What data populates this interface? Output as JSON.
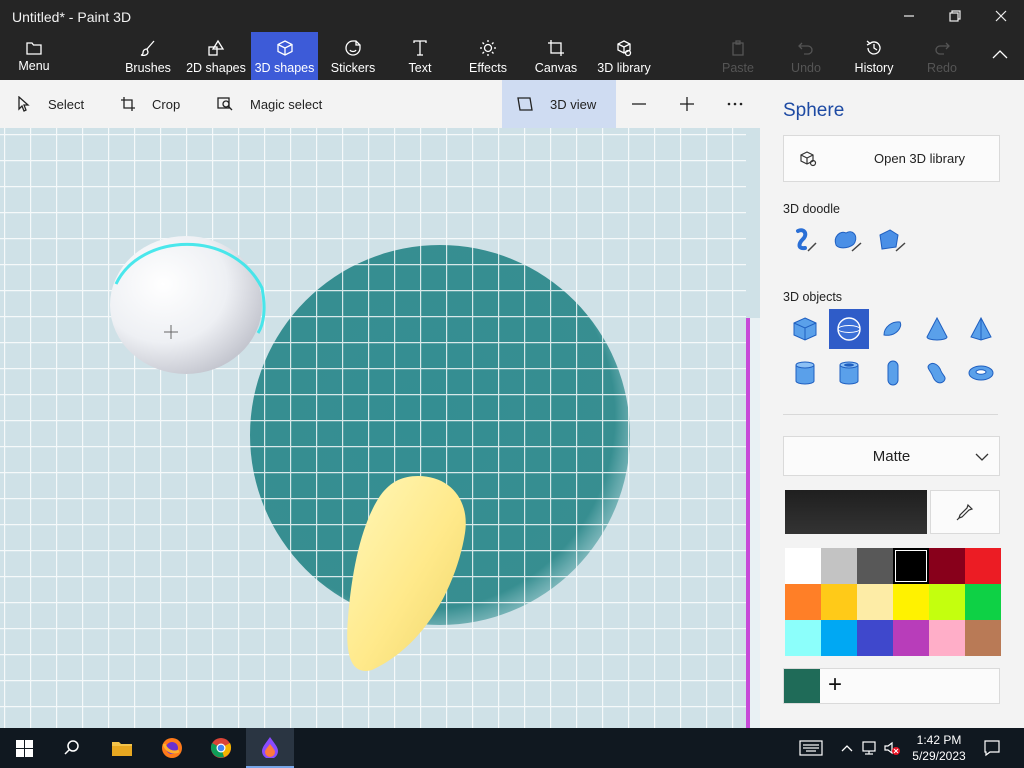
{
  "window": {
    "title": "Untitled* - Paint 3D"
  },
  "ribbon": {
    "items": [
      {
        "label": "Menu",
        "icon": "folder-icon"
      },
      {
        "label": "Brushes",
        "icon": "brush-icon"
      },
      {
        "label": "2D shapes",
        "icon": "2d-shapes-icon"
      },
      {
        "label": "3D shapes",
        "icon": "cube-icon",
        "active": true
      },
      {
        "label": "Stickers",
        "icon": "sticker-icon"
      },
      {
        "label": "Text",
        "icon": "text-icon"
      },
      {
        "label": "Effects",
        "icon": "effects-icon"
      },
      {
        "label": "Canvas",
        "icon": "canvas-icon"
      },
      {
        "label": "3D library",
        "icon": "3d-library-icon"
      },
      {
        "label": "Paste",
        "icon": "paste-icon",
        "disabled": true
      },
      {
        "label": "Undo",
        "icon": "undo-icon",
        "disabled": true
      },
      {
        "label": "History",
        "icon": "history-icon"
      },
      {
        "label": "Redo",
        "icon": "redo-icon",
        "disabled": true
      }
    ]
  },
  "toolbar": {
    "select": "Select",
    "crop": "Crop",
    "magic_select": "Magic select",
    "view_3d": "3D view"
  },
  "panel": {
    "title": "Sphere",
    "open_library": "Open 3D library",
    "doodle_label": "3D doodle",
    "objects_label": "3D objects",
    "material": "Matte",
    "selected_object": "sphere",
    "current_color": "#1f6b58",
    "palette": [
      "#ffffff",
      "#c3c3c3",
      "#585858",
      "#000000",
      "#88001b",
      "#ec1c24",
      "#ff7f27",
      "#ffca18",
      "#fdeca6",
      "#fff200",
      "#c4ff0e",
      "#0ed145",
      "#8cfffb",
      "#00a8f3",
      "#3f48cc",
      "#b83dba",
      "#ffaec8",
      "#b97a56"
    ]
  },
  "taskbar": {
    "time": "1:42 PM",
    "date": "5/29/2023"
  },
  "colors": {
    "accent": "#3d5bd8",
    "ribbon_bg": "#252525",
    "panel_title": "#1d4aa3"
  }
}
